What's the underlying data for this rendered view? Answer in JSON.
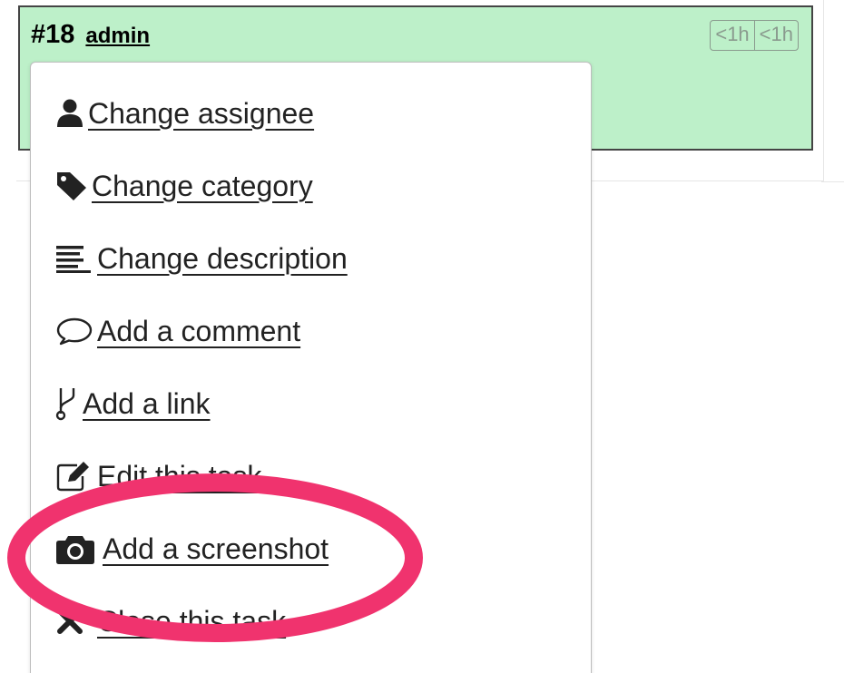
{
  "task": {
    "id": "#18",
    "owner": "admin",
    "time_estimated": "<1h",
    "time_spent": "<1h",
    "card_color": "#bdf0c9"
  },
  "menu": {
    "items": [
      {
        "label": "Change assignee",
        "icon": "user-icon"
      },
      {
        "label": "Change category",
        "icon": "tag-icon"
      },
      {
        "label": "Change description",
        "icon": "align-left-icon"
      },
      {
        "label": "Add a comment",
        "icon": "comment-icon"
      },
      {
        "label": "Add a link",
        "icon": "code-fork-icon"
      },
      {
        "label": "Edit this task",
        "icon": "edit-icon"
      },
      {
        "label": "Add a screenshot",
        "icon": "camera-icon"
      },
      {
        "label": "Close this task",
        "icon": "close-icon"
      }
    ]
  },
  "annotation": {
    "highlight_color": "#f0336e",
    "highlighted_item": "Add a screenshot"
  }
}
